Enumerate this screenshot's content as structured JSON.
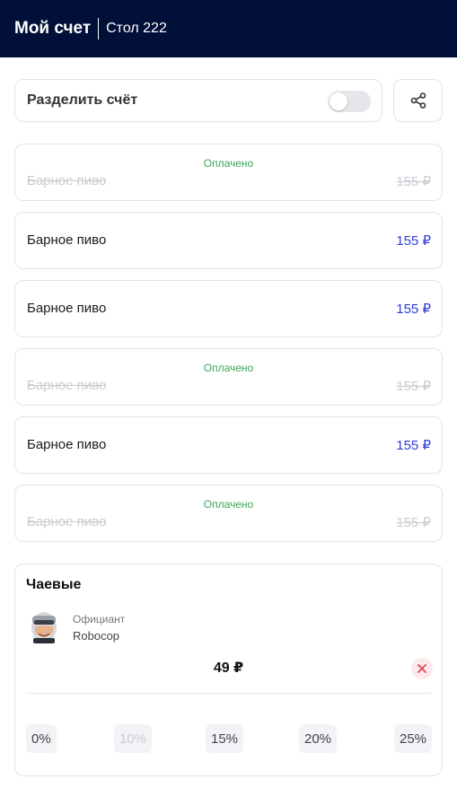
{
  "header": {
    "title": "Мой счет",
    "table": "Стол 222"
  },
  "split": {
    "label": "Разделить счёт",
    "enabled": false
  },
  "items": [
    {
      "name": "Барное пиво",
      "price": "155 ₽",
      "status": "Оплачено",
      "paid": true
    },
    {
      "name": "Барное пиво",
      "price": "155 ₽",
      "status": "",
      "paid": false
    },
    {
      "name": "Барное пиво",
      "price": "155 ₽",
      "status": "",
      "paid": false
    },
    {
      "name": "Барное пиво",
      "price": "155 ₽",
      "status": "Оплачено",
      "paid": true
    },
    {
      "name": "Барное пиво",
      "price": "155 ₽",
      "status": "",
      "paid": false
    },
    {
      "name": "Барное пиво",
      "price": "155 ₽",
      "status": "Оплачено",
      "paid": true
    }
  ],
  "tips": {
    "title": "Чаевые",
    "waiter_role": "Официант",
    "waiter_name": "Robocop",
    "amount": "49 ₽",
    "options": [
      {
        "label": "0%",
        "disabled": false
      },
      {
        "label": "10%",
        "disabled": true
      },
      {
        "label": "15%",
        "disabled": false
      },
      {
        "label": "20%",
        "disabled": false
      },
      {
        "label": "25%",
        "disabled": false
      }
    ]
  },
  "colors": {
    "header_bg": "#001038",
    "price": "#2f3cdc",
    "paid_status": "#3aa556",
    "muted": "#c9cbd1"
  },
  "icons": {
    "share": "share-icon",
    "clear": "close-icon"
  }
}
